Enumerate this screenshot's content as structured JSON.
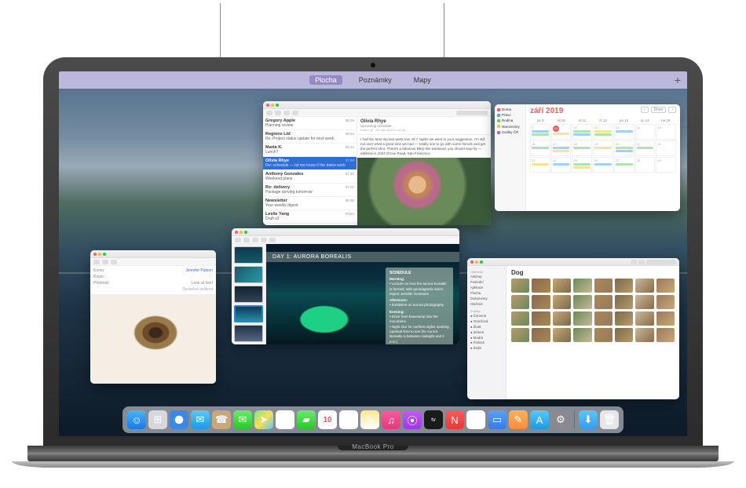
{
  "device": {
    "brand": "MacBook Pro"
  },
  "spaces": {
    "items": [
      {
        "label": "Plocha",
        "active": true
      },
      {
        "label": "Poznámky",
        "active": false
      },
      {
        "label": "Mapy",
        "active": false
      }
    ],
    "add": "+"
  },
  "mail": {
    "messages": [
      {
        "from": "Gregory Apple",
        "subj": "Planning review",
        "date": "08:29"
      },
      {
        "from": "Regions Ltd",
        "subj": "Re: Project status update for next week",
        "date": "08:24"
      },
      {
        "from": "Marta K.",
        "subj": "Lunch?",
        "date": "08:12"
      },
      {
        "from": "Olivia Rhye",
        "subj": "Fw: schedule — let me know if the dates work",
        "date": "07:58",
        "selected": true
      },
      {
        "from": "Anthony Gonzales",
        "subj": "Weekend plans",
        "date": "07:40"
      },
      {
        "from": "Re: delivery",
        "subj": "Package arriving tomorrow",
        "date": "07:21"
      },
      {
        "from": "Newsletter",
        "subj": "Your weekly digest",
        "date": "06:55"
      },
      {
        "from": "Leslie Yang",
        "subj": "Draft v2",
        "date": "Včera"
      }
    ],
    "open": {
      "from": "Olivia Rhye",
      "subject": "Upcoming schedule",
      "meta": "Komu: já · 28. září 2019 v 19:46",
      "body": "I had the best trip last week too! All 7 nights we went to your suggestion, I'm still not over what a great time we had — totally one to go with some friends and get the perfect shot. There's a fabulous BBQ this weekend, you should stop by — address is 1024 Grove Road, San Francisco."
    }
  },
  "calendar": {
    "month": "září 2019",
    "nav": {
      "prev": "‹",
      "today": "Dnes",
      "next": "›"
    },
    "sidebars": [
      "Doma",
      "Práce",
      "Rodina",
      "Narozeniny",
      "Svátky ČR"
    ],
    "days": [
      "po 9",
      "út 10",
      "st 11",
      "čt 12",
      "pá 13",
      "so 14",
      "ne 15"
    ],
    "today_index": 1
  },
  "keynote": {
    "title": "DAY 1: AURORA BOREALIS",
    "panel": {
      "heading1": "SCHEDULE",
      "morning_label": "Morning:",
      "morning1": "• Lecture on how the aurora borealis is formed, with geomagnetic storm expert Jennifer Sorensen",
      "afternoon_label": "Afternoon:",
      "afternoon1": "• Exhibition on aurora photography",
      "evening_label": "Evening:",
      "evening1": "• Drive from basecamp into the mountains",
      "evening2": "• Night tour for northern lights spotting (optimal time to see the Aurora Borealis is between midnight and 2 a.m.)"
    }
  },
  "compose": {
    "to_label": "Komu:",
    "to_value": "Jennifer Patson",
    "cc_label": "Kopie:",
    "subject_label": "Předmět:",
    "subject_value": "Look at him!",
    "size_label": "Skutečná velikost"
  },
  "finder": {
    "title": "Dog",
    "sidebar": {
      "favorites_header": "Oblíbené",
      "items": [
        "AirDrop",
        "Poslední",
        "Aplikace",
        "Plocha",
        "Dokumenty",
        "Stažené"
      ],
      "tags_header": "Značky",
      "tags": [
        "Červená",
        "Oranžová",
        "Žlutá",
        "Zelená",
        "Modrá",
        "Fialová",
        "Šedá"
      ]
    },
    "thumb_count": 32
  },
  "dock": {
    "apps": [
      {
        "name": "finder",
        "bg": "linear-gradient(#4ab4f5,#1a7ae5)",
        "glyph": "☺"
      },
      {
        "name": "launchpad",
        "bg": "#d8d8dc",
        "glyph": "⊞"
      },
      {
        "name": "safari",
        "bg": "radial-gradient(circle,#fff 30%,#3a8ae5 32%)",
        "glyph": "✦"
      },
      {
        "name": "mail",
        "bg": "linear-gradient(#5ac8fa,#1a9ae5)",
        "glyph": "✉"
      },
      {
        "name": "contacts",
        "bg": "#c8a878",
        "glyph": "☎"
      },
      {
        "name": "messages",
        "bg": "linear-gradient(#6ee86e,#2ac82a)",
        "glyph": "✉"
      },
      {
        "name": "maps",
        "bg": "linear-gradient(135deg,#7ae57a,#f5e05a,#5ac8fa)",
        "glyph": "➤"
      },
      {
        "name": "photos",
        "bg": "#fff",
        "glyph": "✿"
      },
      {
        "name": "facetime",
        "bg": "linear-gradient(#6ee86e,#2ac82a)",
        "glyph": "▰"
      },
      {
        "name": "calendar",
        "bg": "#fff",
        "glyph": "10"
      },
      {
        "name": "reminders",
        "bg": "#fff",
        "glyph": "☰"
      },
      {
        "name": "notes",
        "bg": "linear-gradient(#ffe68a,#fff)",
        "glyph": "✎"
      },
      {
        "name": "music",
        "bg": "linear-gradient(#fa5aa0,#e53a7a)",
        "glyph": "♫"
      },
      {
        "name": "podcasts",
        "bg": "linear-gradient(#c85af5,#9a3ae5)",
        "glyph": "⦿"
      },
      {
        "name": "tv",
        "bg": "#1a1a1a",
        "glyph": "tv"
      },
      {
        "name": "news",
        "bg": "linear-gradient(#ff5a5a,#e53a3a)",
        "glyph": "N"
      },
      {
        "name": "numbers",
        "bg": "#fff",
        "glyph": "▤"
      },
      {
        "name": "keynote",
        "bg": "linear-gradient(#5aa0fa,#3a7ae5)",
        "glyph": "▭"
      },
      {
        "name": "pages",
        "bg": "linear-gradient(#ffb05a,#ff8a3a)",
        "glyph": "✎"
      },
      {
        "name": "appstore",
        "bg": "linear-gradient(#5ac8fa,#1a9ae5)",
        "glyph": "A"
      },
      {
        "name": "preferences",
        "bg": "#8a8a8e",
        "glyph": "⚙"
      }
    ],
    "extras": [
      {
        "name": "downloads",
        "bg": "linear-gradient(#5ac8fa,#3a9ae5)",
        "glyph": "⬇"
      },
      {
        "name": "trash",
        "bg": "#e6e6e8",
        "glyph": "🗑"
      }
    ]
  }
}
